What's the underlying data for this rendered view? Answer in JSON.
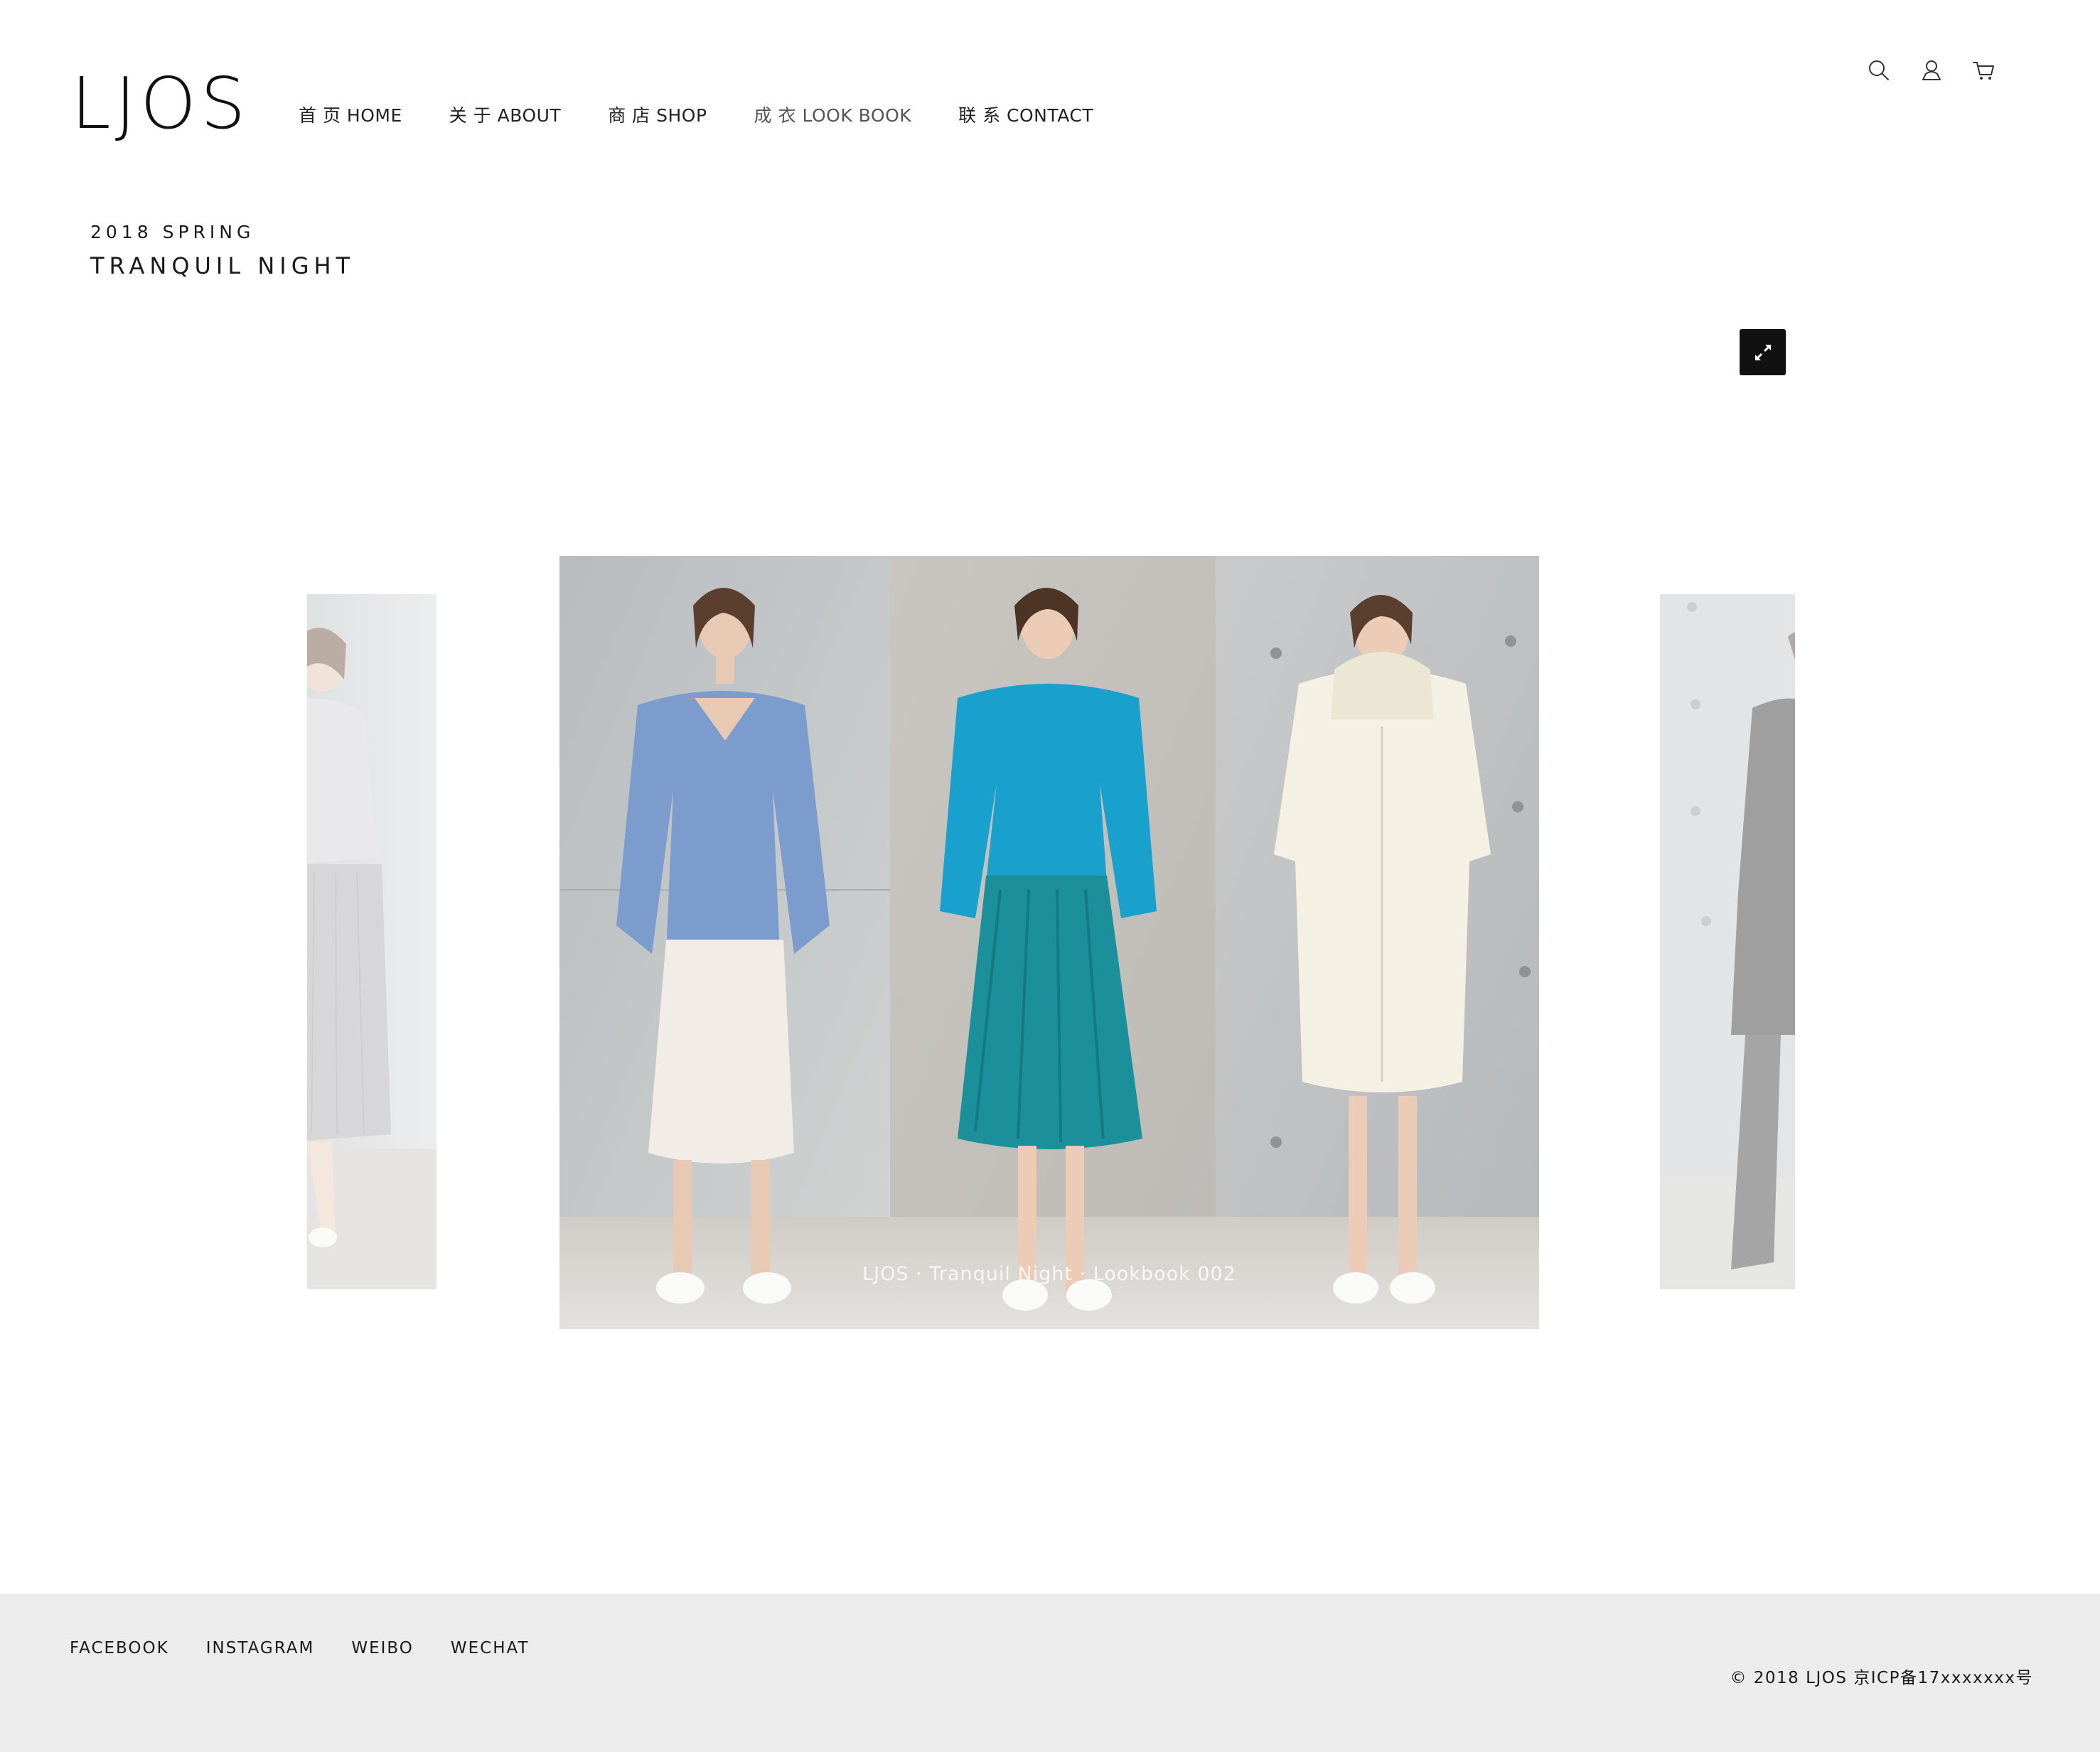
{
  "brand": {
    "logo": "LJOS"
  },
  "nav": {
    "items": [
      {
        "label": "首 页 HOME"
      },
      {
        "label": "关 于 ABOUT"
      },
      {
        "label": "商 店 SHOP"
      },
      {
        "label": "成 衣 LOOK BOOK"
      },
      {
        "label": "联 系 CONTACT"
      }
    ],
    "active_index": 3
  },
  "header_icons": [
    "search-icon",
    "user-icon",
    "cart-icon"
  ],
  "collection": {
    "season": "2018 SPRING",
    "name": "TRANQUIL NIGHT"
  },
  "gallery": {
    "caption": "LJOS · Tranquil Night · Lookbook 002",
    "fullscreen_icon": "expand-icon"
  },
  "colors": {
    "background": "#ffffff",
    "footer_bg": "#ececec",
    "text": "#1a1a1a",
    "button_bg": "#111111"
  },
  "footer": {
    "social": [
      {
        "label": "FACEBOOK"
      },
      {
        "label": "INSTAGRAM"
      },
      {
        "label": "WEIBO"
      },
      {
        "label": "WECHAT"
      }
    ],
    "copyright": "© 2018 LJOS 京ICP备17xxxxxxx号"
  }
}
